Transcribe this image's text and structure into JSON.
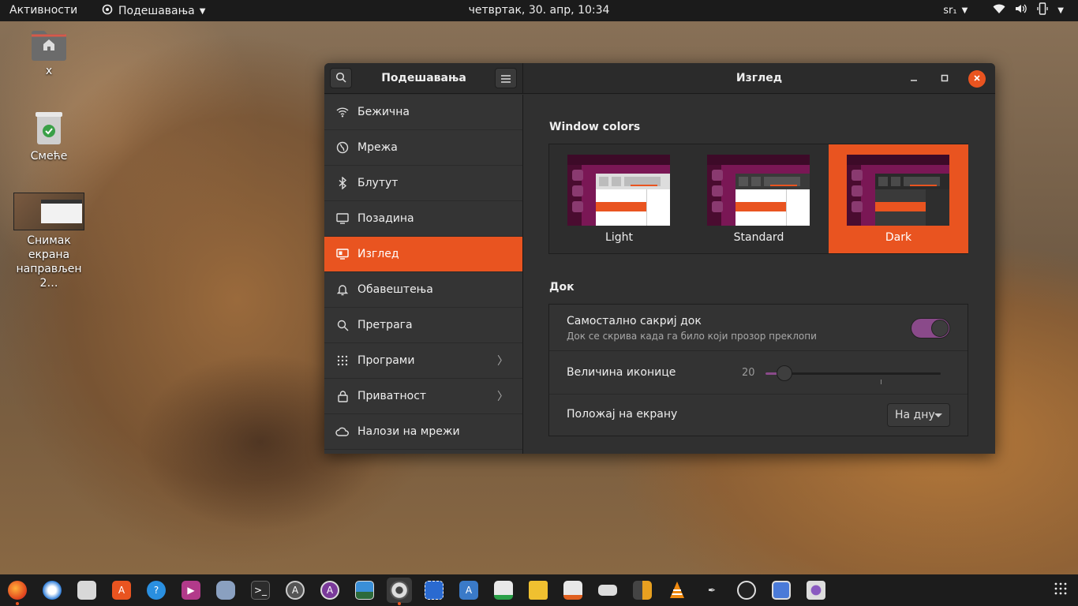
{
  "topbar": {
    "activities": "Активности",
    "app_menu": "Подешавања",
    "clock": "четвртак, 30. апр, 10:34",
    "keyboard_layout": "sr₁"
  },
  "desktop": {
    "icons": [
      {
        "label": "x",
        "icon": "home-folder-icon"
      },
      {
        "label": "Смеће",
        "icon": "trash-icon"
      },
      {
        "label": "Снимак екрана направљен 2…",
        "icon": "screenshot-file-icon"
      }
    ]
  },
  "window": {
    "sidebar_title": "Подешавања",
    "title": "Изглед"
  },
  "sidebar": {
    "items": [
      {
        "label": "Бежична",
        "icon": "wifi-icon"
      },
      {
        "label": "Мрежа",
        "icon": "network-icon"
      },
      {
        "label": "Блутут",
        "icon": "bluetooth-icon"
      },
      {
        "label": "Позадина",
        "icon": "background-icon"
      },
      {
        "label": "Изглед",
        "icon": "appearance-icon",
        "active": true
      },
      {
        "label": "Обавештења",
        "icon": "bell-icon"
      },
      {
        "label": "Претрага",
        "icon": "search-icon"
      },
      {
        "label": "Програми",
        "icon": "apps-grid-icon",
        "chevron": true
      },
      {
        "label": "Приватност",
        "icon": "lock-icon",
        "chevron": true
      },
      {
        "label": "Налози на мрежи",
        "icon": "cloud-icon"
      }
    ]
  },
  "appearance": {
    "window_colors_title": "Window colors",
    "options": [
      {
        "label": "Light"
      },
      {
        "label": "Standard"
      },
      {
        "label": "Dark",
        "selected": true
      }
    ],
    "dock_title": "Док",
    "autohide_label": "Самостално сакриј док",
    "autohide_sub": "Док се скрива када га било који прозор преклопи",
    "autohide_on": true,
    "icon_size_label": "Величина иконице",
    "icon_size_value": "20",
    "icon_size_fraction": 0.07,
    "position_label": "Положај на екрану",
    "position_value": "На дну"
  },
  "colors": {
    "accent": "#e95420",
    "toggle_on": "#8a4a8a"
  },
  "dock_apps": [
    "firefox-icon",
    "thunderbird-icon",
    "files-icon",
    "software-center-icon",
    "help-icon",
    "video-icon",
    "usb-creator-icon",
    "terminal-icon",
    "software-updater-icon",
    "app-store-icon",
    "screenshot-tool-icon",
    "settings-icon",
    "screen-selection-icon",
    "translate-icon",
    "spreadsheet-icon",
    "archive-icon",
    "presentation-icon",
    "keyboard-icon",
    "calculator-icon",
    "vlc-icon",
    "inkscape-icon",
    "obs-icon",
    "remote-desktop-icon",
    "webcam-icon"
  ]
}
